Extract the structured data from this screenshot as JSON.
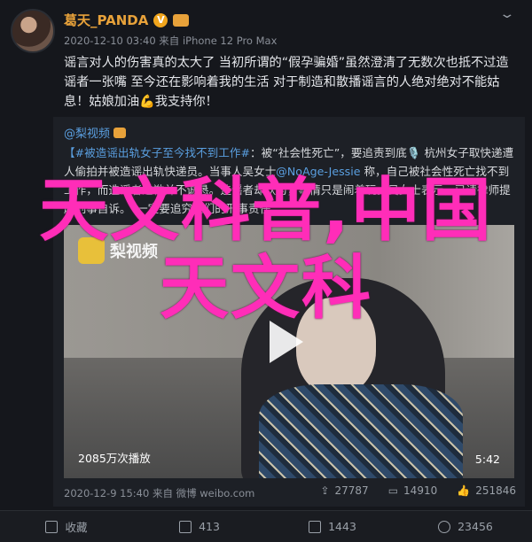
{
  "author": {
    "name": "葛天_PANDA",
    "verified_badge": "V"
  },
  "meta": {
    "time": "2020-12-10 03:40",
    "source": "来自 iPhone 12 Pro Max"
  },
  "content": "谣言对人的伤害真的太大了 当初所谓的“假孕骗婚”虽然澄清了无数次也抵不过造谣者一张嘴 至今还在影响着我的生活 对于制造和散播谣言的人绝对绝对不能姑息！姑娘加油💪我支持你！",
  "retweet": {
    "user": "@梨视频",
    "text_hashtag": "【#被造谣出轨女子至今找不到工作#",
    "text_part1": "：被“社会性死亡”，要追责到底🎙️ 杭州女子取快递遭人偷拍并被造谣出轨快递员。当事人吴女士",
    "mention": "@NoAge-Jessie",
    "text_part2": " 称，自己被社会性死亡找不到工作，而造谣者道歉并不诚恳。造谣者却认为，事情只是闹着玩。吴女士表示，已请律师提起刑事自诉。“一定要追究他们的刑事责任。”",
    "video": {
      "logo": "梨视频",
      "views": "2085万次播放",
      "duration": "5:42"
    },
    "time": "2020-12-9 15:40",
    "source": "来自 微博 weibo.com",
    "stats": {
      "shares": "27787",
      "comments": "14910",
      "likes": "251846"
    }
  },
  "overlay": {
    "line1": "天文科普,中国",
    "line2": "天文科"
  },
  "actions": {
    "repost": "收藏",
    "share_count": "413",
    "comment_count": "1443",
    "like_count": "23456"
  }
}
